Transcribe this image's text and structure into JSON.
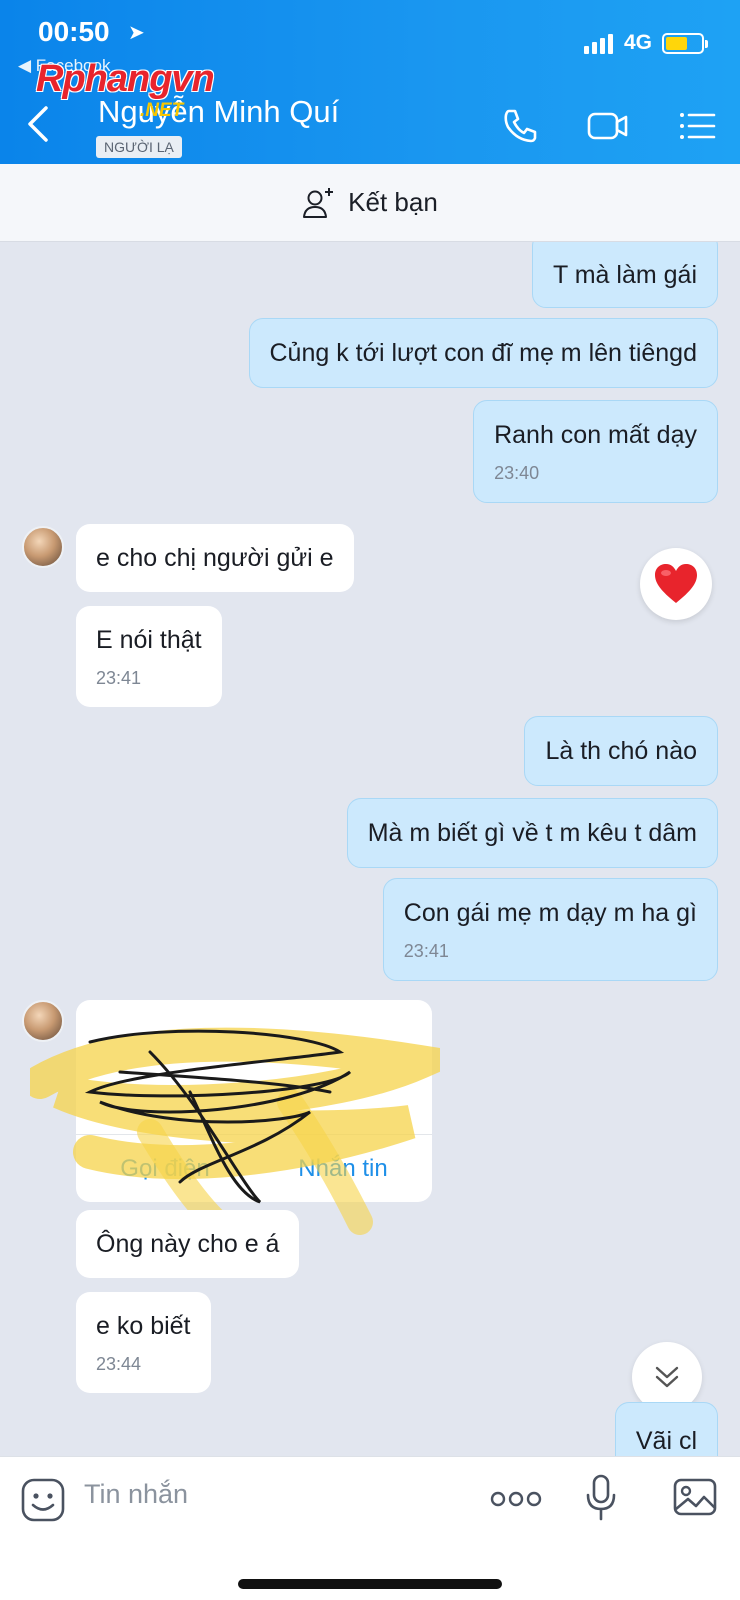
{
  "status_bar": {
    "time": "00:50",
    "back_app": "◀ Facebook",
    "network": "4G"
  },
  "watermark": {
    "brand": "Rphangvn",
    "suffix": ".NET"
  },
  "header": {
    "contact_name": "Nguyễn Minh Quí",
    "badge": "NGƯỜI LẠ"
  },
  "friend_bar": {
    "label": "Kết bạn"
  },
  "messages": [
    {
      "side": "sent",
      "text": "T mà làm gái"
    },
    {
      "side": "sent",
      "text": "Củng k tới lượt con đĩ mẹ m lên tiêngd"
    },
    {
      "side": "sent",
      "text": "Ranh con mất dạy",
      "time": "23:40"
    },
    {
      "side": "recv",
      "text": "e cho chị người gửi e"
    },
    {
      "side": "recv",
      "text": "E nói thật",
      "time": "23:41"
    },
    {
      "side": "sent",
      "text": "Là th chó nào"
    },
    {
      "side": "sent",
      "text": "Mà m biết gì về t m kêu t dâm"
    },
    {
      "side": "sent",
      "text": "Con gái mẹ m dạy m ha gì",
      "time": "23:41"
    },
    {
      "side": "recv",
      "text": "Ông này cho e á"
    },
    {
      "side": "recv",
      "text": "e ko biết",
      "time": "23:44"
    },
    {
      "side": "sent",
      "text": "Vãi cl"
    }
  ],
  "contact_card": {
    "call_label": "Gọi điện",
    "message_label": "Nhắn tin"
  },
  "input": {
    "placeholder": "Tin nhắn"
  },
  "colors": {
    "header": "#0a84ea",
    "sent_bubble": "#cce9fd",
    "received_bubble": "#ffffff",
    "link": "#1e8fe8"
  }
}
